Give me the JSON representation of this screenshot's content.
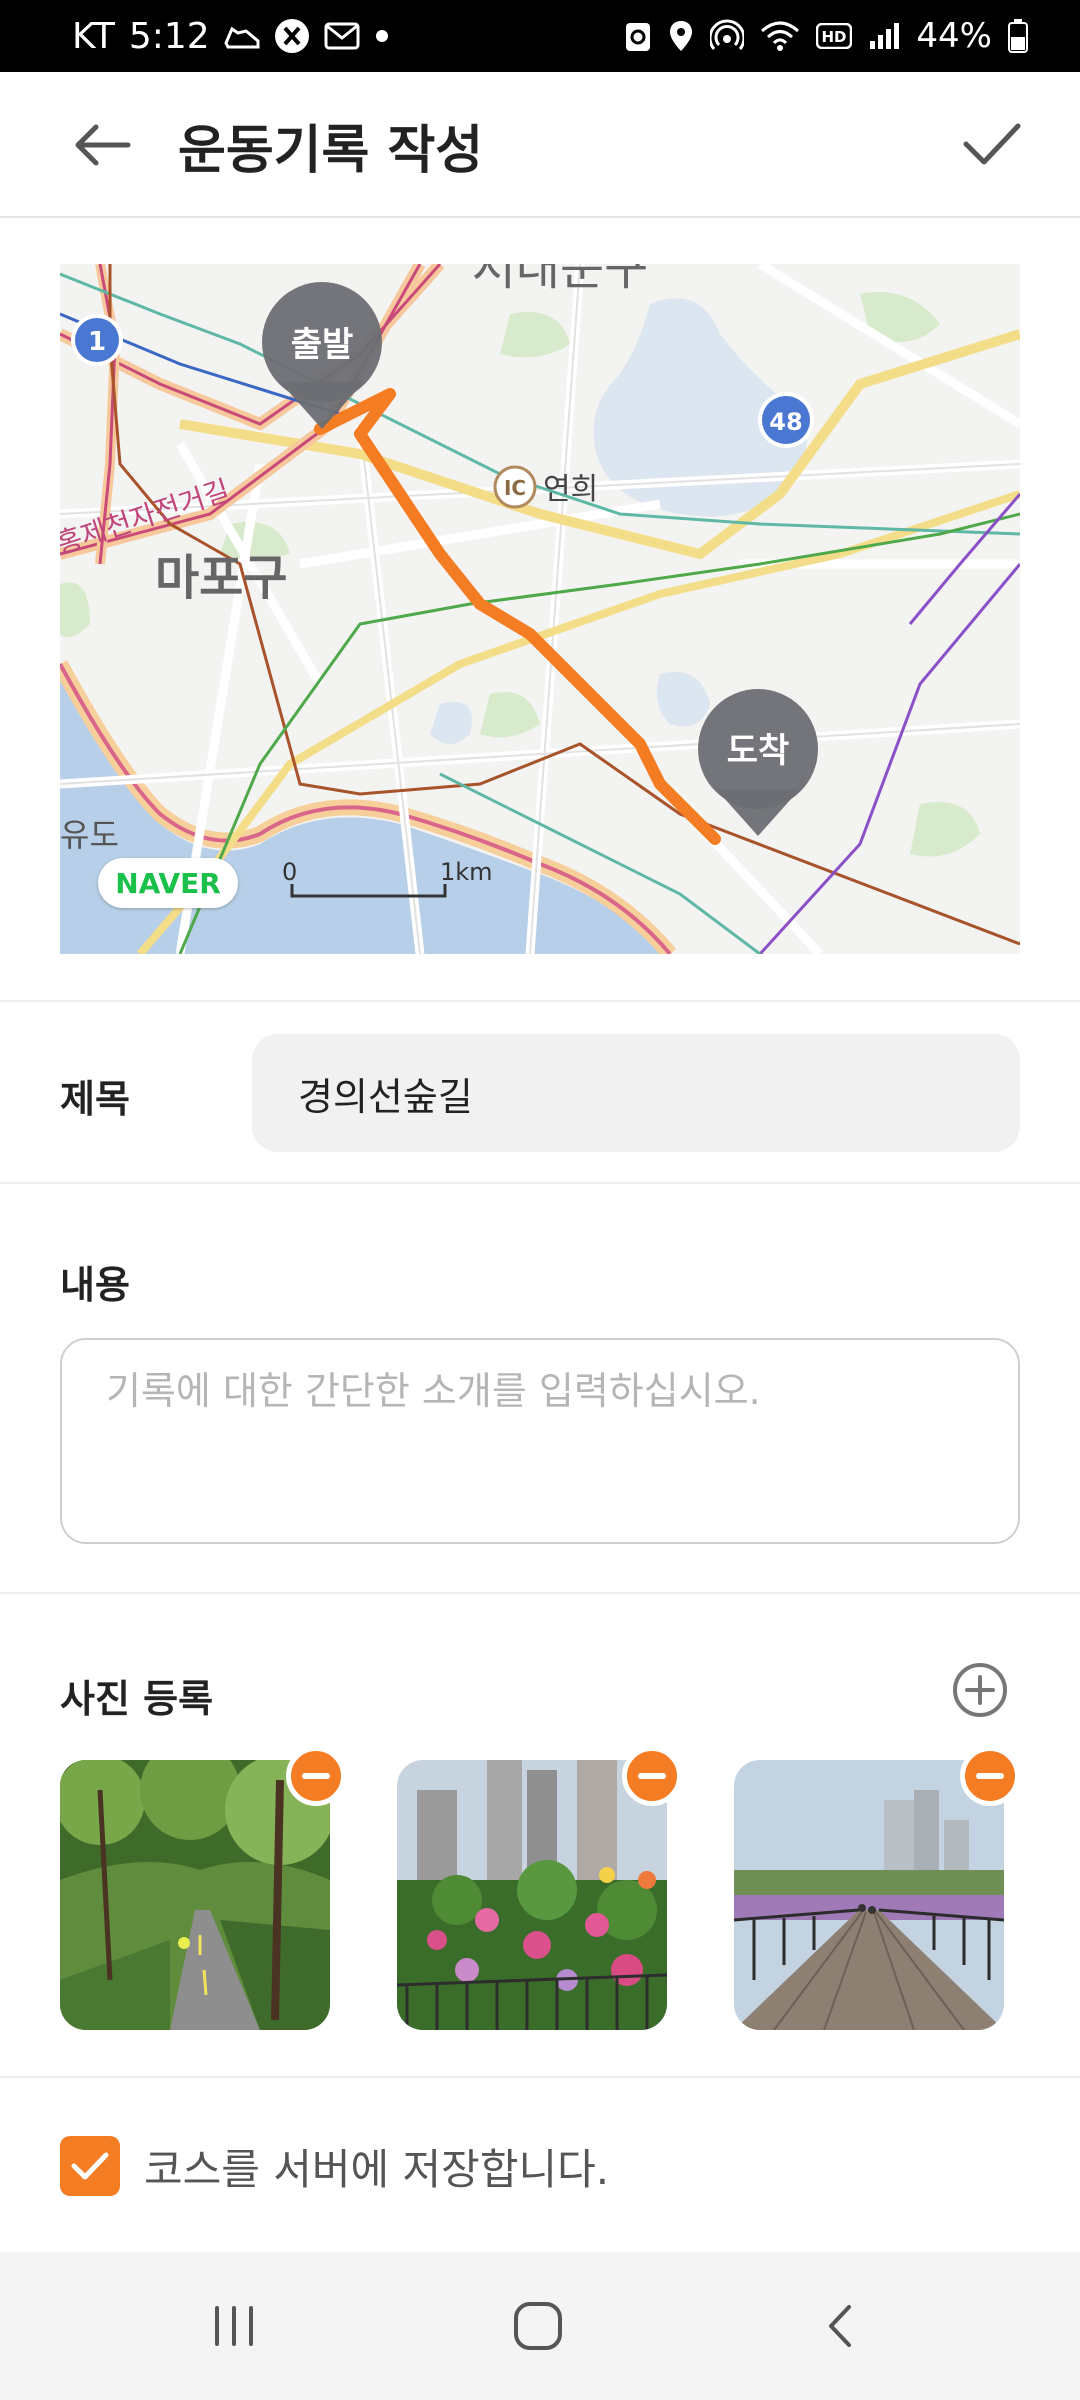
{
  "status_bar": {
    "carrier": "KT",
    "time": "5:12",
    "battery": "44%",
    "left_icons": [
      "shoe-icon",
      "x-app-icon",
      "mail-icon",
      "dot-icon"
    ],
    "right_icons": [
      "recycle-icon",
      "location-icon",
      "hotspot-icon",
      "wifi-icon",
      "hd-icon",
      "signal-icon",
      "battery-icon"
    ]
  },
  "header": {
    "title": "운동기록 작성",
    "back_icon": "arrow-left-icon",
    "confirm_icon": "checkmark-icon"
  },
  "map": {
    "start_label": "출발",
    "end_label": "도착",
    "district_label": "마포구",
    "top_partial_label": "서대문구",
    "road_label": "홍제천자전거길",
    "ic_badge": "IC",
    "ic_name": "연희",
    "left_partial_label": "유도",
    "route_1": "1",
    "route_48": "48",
    "scale_start": "0",
    "scale_end": "1km",
    "provider": "NAVER",
    "route_color": "#f47c22"
  },
  "form": {
    "title_label": "제목",
    "title_value": "경의선숲길",
    "content_label": "내용",
    "content_placeholder": "기록에 대한 간단한 소개를 입력하십시오."
  },
  "photos": {
    "section_label": "사진 등록",
    "add_icon": "plus-circle-icon",
    "items": [
      {
        "name": "tree-path-photo",
        "remove_icon": "minus-circle-icon"
      },
      {
        "name": "flowers-photo",
        "remove_icon": "minus-circle-icon"
      },
      {
        "name": "bridge-photo",
        "remove_icon": "minus-circle-icon"
      }
    ]
  },
  "save_option": {
    "checked": true,
    "label": "코스를 서버에 저장합니다."
  },
  "nav": {
    "icons": [
      "recent-apps-icon",
      "home-icon",
      "back-icon"
    ]
  },
  "colors": {
    "accent": "#f47c22",
    "marker": "#6b6e73"
  }
}
